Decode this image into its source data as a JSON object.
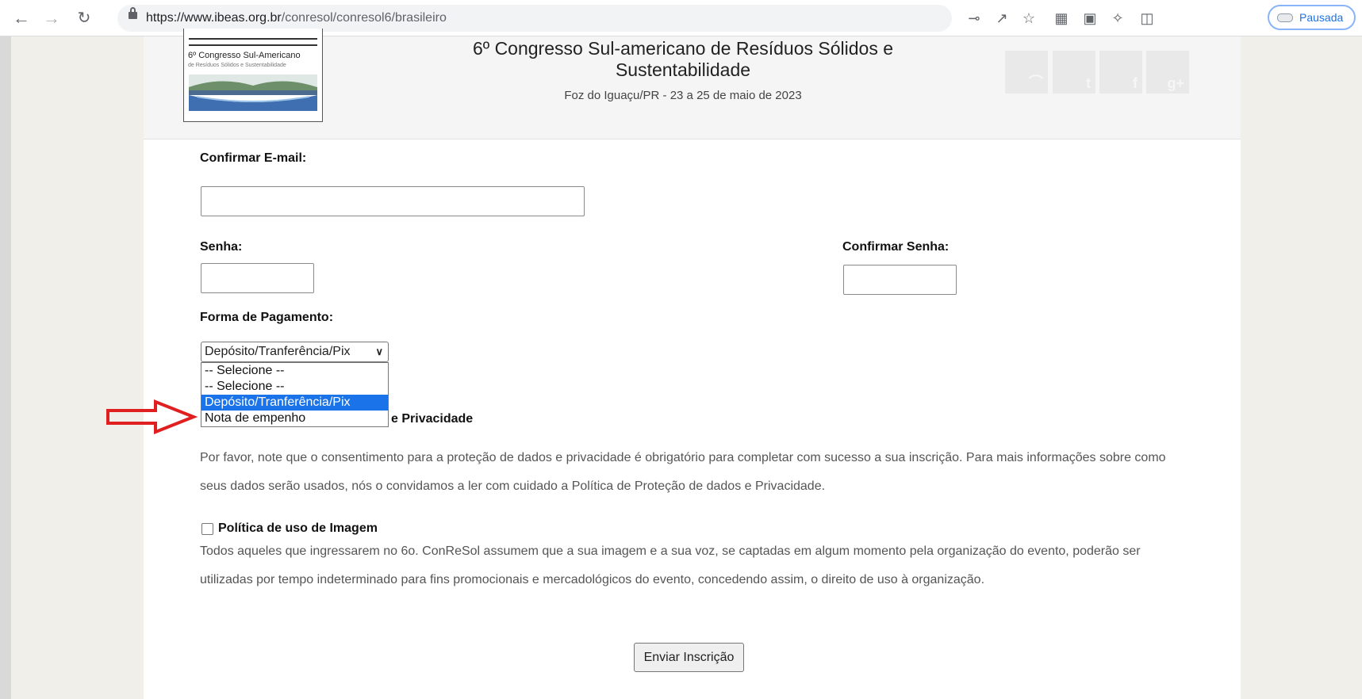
{
  "browser": {
    "url_host": "https://www.ibeas.org.br",
    "url_path": "/conresol/conresol6/brasileiro",
    "profile_label": "Pausada"
  },
  "header": {
    "title": "6º Congresso Sul-americano de Resíduos Sólidos e Sustentabilidade",
    "subtitle": "Foz do Iguaçu/PR - 23 a 25 de maio de 2023",
    "logo_text": "6º Congresso Sul-Americano",
    "logo_subtext": "de Resíduos Sólidos e Sustentabilidade",
    "social": [
      {
        "name": "rss-icon",
        "glyph": "☰"
      },
      {
        "name": "twitter-icon",
        "glyph": "t"
      },
      {
        "name": "facebook-icon",
        "glyph": "f"
      },
      {
        "name": "google-plus-icon",
        "glyph": "g+"
      }
    ]
  },
  "form": {
    "confirm_email_label": "Confirmar E-mail:",
    "password_label": "Senha:",
    "confirm_password_label": "Confirmar Senha:",
    "payment_label": "Forma de Pagamento:",
    "payment_selected": "Depósito/Tranferência/Pix",
    "payment_options": [
      "-- Selecione --",
      "-- Selecione --",
      "Depósito/Tranferência/Pix",
      "Nota de empenho"
    ],
    "privacy_heading_visible": "e Privacidade",
    "privacy_text": "Por favor, note que o consentimento para a proteção de dados e privacidade é obrigatório para completar com sucesso a sua inscrição. Para mais informações sobre como seus dados serão usados, nós o convidamos a ler com cuidado a Política de Proteção de dados e Privacidade.",
    "image_policy_label": "Política de uso de Imagem",
    "image_policy_text": "Todos aqueles que ingressarem no 6o. ConReSol assumem que a sua imagem e a sua voz, se captadas em algum momento pela organização do evento, poderão ser utilizadas por tempo indeterminado para fins promocionais e mercadológicos do evento, concedendo assim, o direito de uso à organização.",
    "submit_label": "Enviar Inscrição"
  },
  "annotation": {
    "color": "#e02020"
  }
}
